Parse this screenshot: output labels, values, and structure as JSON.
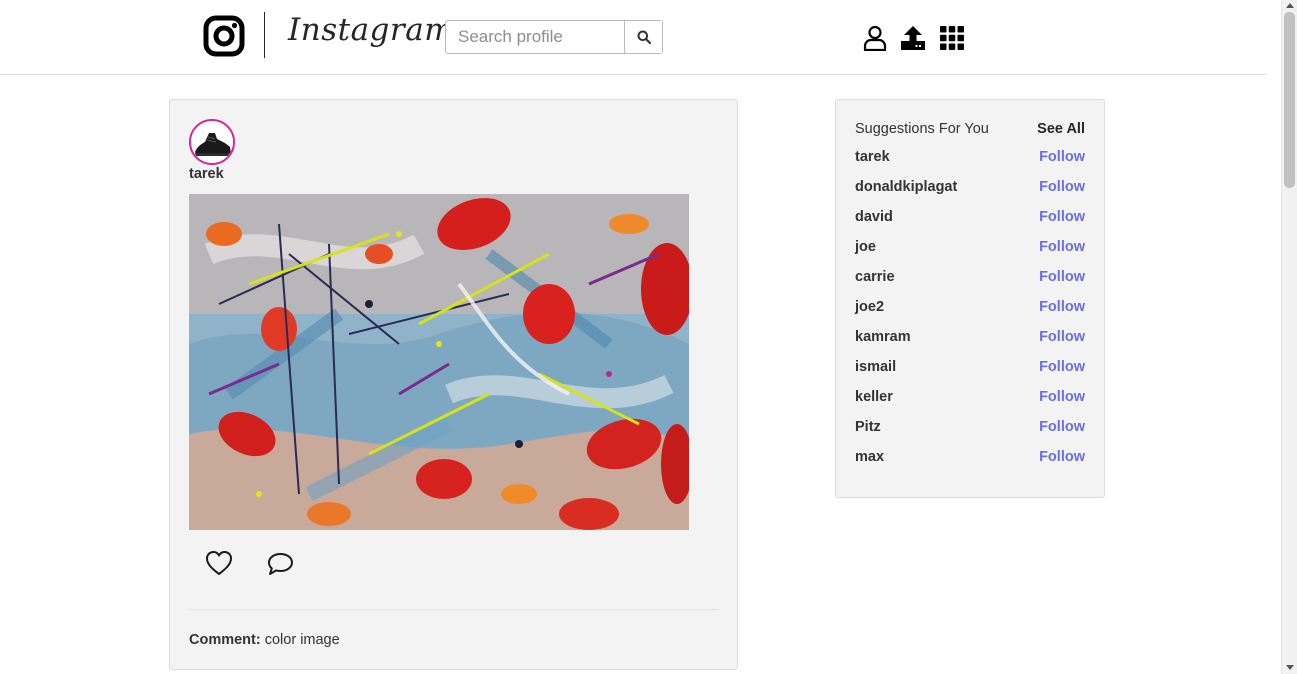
{
  "header": {
    "wordmark": "Instagram",
    "search": {
      "placeholder": "Search profile",
      "value": ""
    },
    "icons": [
      "instagram-logo-icon",
      "search-icon",
      "profile-icon",
      "upload-icon",
      "grid-menu-icon"
    ]
  },
  "post": {
    "author": "tarek",
    "comment_label": "Comment:",
    "comment_text": "color image",
    "icons": [
      "heart-icon",
      "comment-icon"
    ]
  },
  "suggestions": {
    "title": "Suggestions For You",
    "see_all": "See All",
    "follow_label": "Follow",
    "users": [
      "tarek",
      "donaldkiplagat",
      "david",
      "joe",
      "carrie",
      "joe2",
      "kamram",
      "ismail",
      "keller",
      "Pitz",
      "max"
    ]
  },
  "colors": {
    "accent": "#6b6ee0",
    "card_bg": "#f3f3f3",
    "avatar_ring": "#d6249f"
  }
}
